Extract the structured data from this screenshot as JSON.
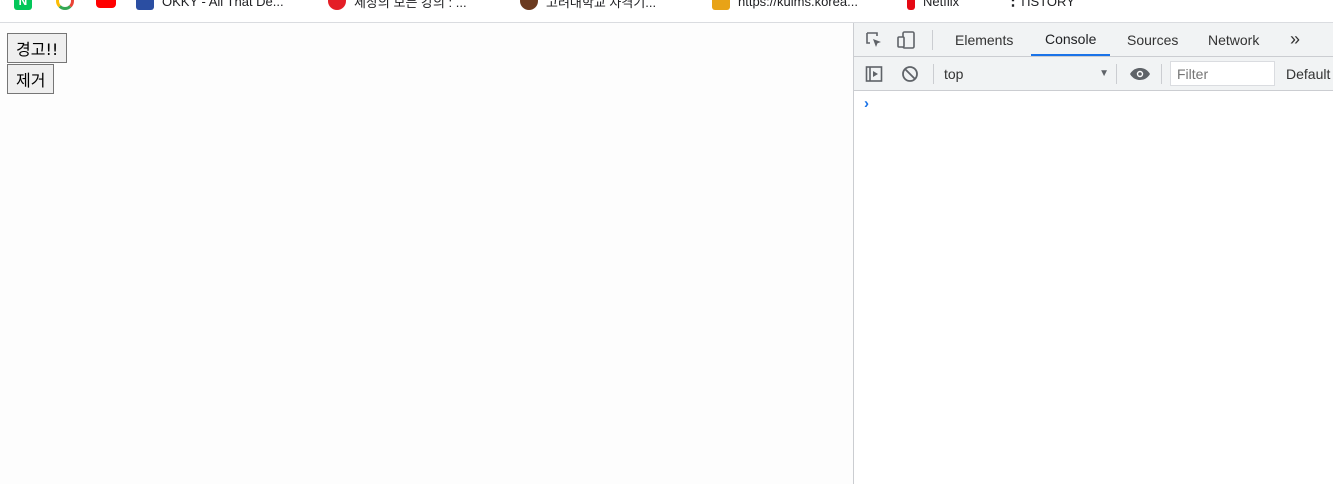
{
  "bookmarks": [
    {
      "icon": "naver-icon",
      "label": "",
      "color": "#03c75a"
    },
    {
      "icon": "google-icon",
      "label": "",
      "color": "#4285f4"
    },
    {
      "icon": "youtube-icon",
      "label": "",
      "color": "#ff0000"
    },
    {
      "icon": "okky-icon",
      "label": "OKKY - All That De...",
      "color": "#2b4ea2"
    },
    {
      "icon": "shield-icon",
      "label": "세상의 모든 강의 : ...",
      "color": "#e41e26"
    },
    {
      "icon": "tiger-emblem-icon",
      "label": "고려대학교 자격기...",
      "color": "#6b3a1f"
    },
    {
      "icon": "pencil-icon",
      "label": "https://kulms.korea...",
      "color": "#e8a317"
    },
    {
      "icon": "netflix-icon",
      "label": "Netflix",
      "color": "#e50914"
    },
    {
      "icon": "more-vertical-icon",
      "label": "TISTORY",
      "color": "#202124"
    }
  ],
  "page": {
    "warn_button": "경고!!",
    "remove_button": "제거"
  },
  "devtools": {
    "tabs": [
      "Elements",
      "Console",
      "Sources",
      "Network"
    ],
    "active_tab": "Console",
    "more_tabs": "»",
    "context": "top",
    "filter_placeholder": "Filter",
    "levels": "Default",
    "prompt": "›",
    "accent": "#1a73e8"
  }
}
